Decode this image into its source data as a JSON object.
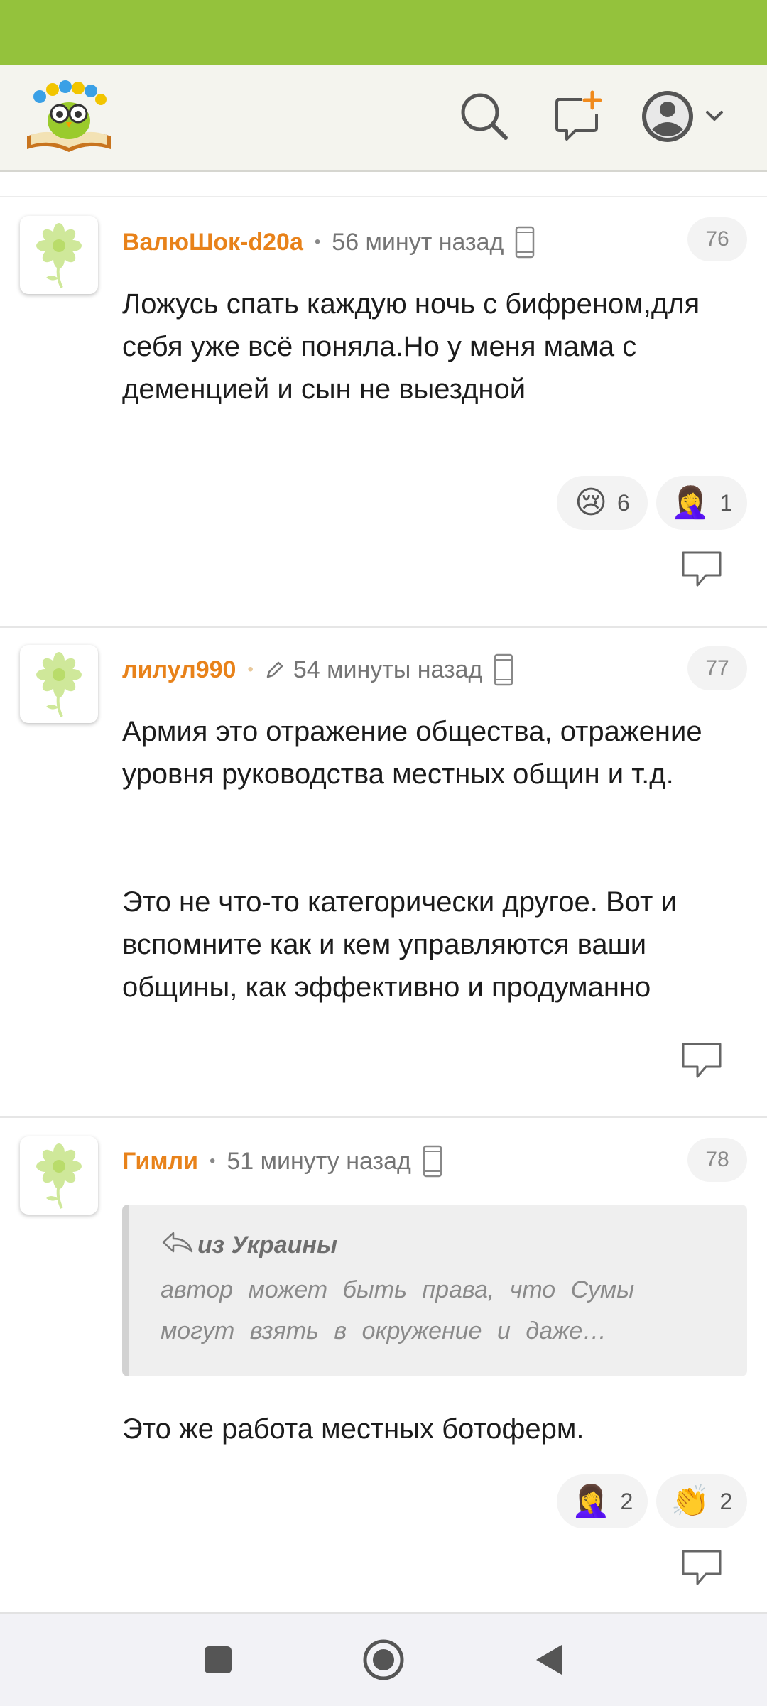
{
  "colors": {
    "status_bar": "#94c23c",
    "author": "#e8821a",
    "brand_green": "#94c23c"
  },
  "header": {
    "logo_icon": "owl-book-logo",
    "icons": [
      "search-icon",
      "add-post-icon",
      "profile-avatar-icon",
      "chevron-down-icon"
    ]
  },
  "comments": [
    {
      "author": "ВалюШок-d20a",
      "time": "56 минут назад",
      "number": "76",
      "text": "Ложусь спать каждую ночь с бифреном,для себя уже всё поняла.Но у меня мама с деменцией и сын не выездной",
      "reactions": [
        {
          "emoji": "😢",
          "count": "6"
        },
        {
          "emoji": "🤦‍♀️",
          "count": "1"
        }
      ]
    },
    {
      "author": "лилул990",
      "time": "54 минуты назад",
      "number": "77",
      "text_p1": "Армия это отражение общества, отражение уровня руководства местных общин и т.д.",
      "text_p2": "Это не что-то категорически другое. Вот и вспомните как и кем управляются ваши общины, как эффективно и продуманно"
    },
    {
      "author": "Гимли",
      "time": "51 минуту назад",
      "number": "78",
      "quote": {
        "author": "из Украины",
        "text": "автор может быть права, что Сумы могут взять в окружение и даже захватить. в..."
      },
      "text": "Это же работа местных ботоферм.",
      "reactions": [
        {
          "emoji": "🤦‍♀️",
          "count": "2"
        },
        {
          "emoji": "👏",
          "count": "2"
        }
      ]
    }
  ],
  "navbar": {
    "icons": [
      "recent-apps-icon",
      "home-icon",
      "back-icon"
    ]
  }
}
